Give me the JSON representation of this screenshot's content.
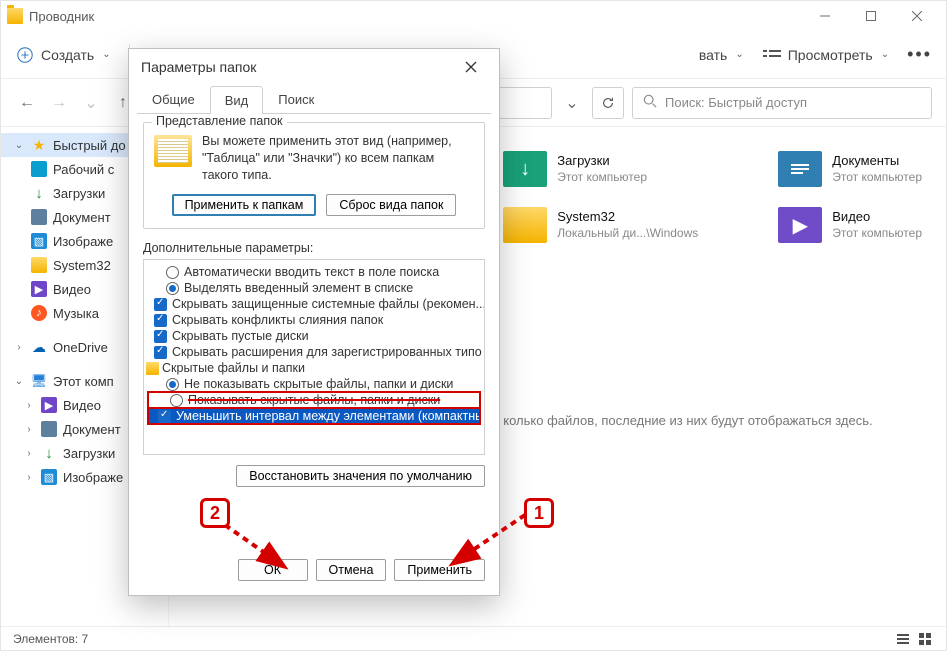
{
  "title": "Проводник",
  "toolbar": {
    "create": "Создать",
    "sort": "вать",
    "view": "Просмотреть"
  },
  "nav": {
    "search_placeholder": "Поиск: Быстрый доступ"
  },
  "sidebar": {
    "quick_access": "Быстрый до",
    "desktop": "Рабочий с",
    "downloads": "Загрузки",
    "documents": "Документ",
    "images": "Изображе",
    "system32": "System32",
    "video": "Видео",
    "music": "Музыка",
    "onedrive": "OneDrive",
    "this_pc": "Этот комп",
    "pc_video": "Видео",
    "pc_documents": "Документ",
    "pc_downloads": "Загрузки",
    "pc_images": "Изображе"
  },
  "folders": {
    "downloads": {
      "title": "Загрузки",
      "sub": "Этот компьютер"
    },
    "system32": {
      "title": "System32",
      "sub": "Локальный ди...\\Windows"
    },
    "documents": {
      "title": "Документы",
      "sub": "Этот компьютер"
    },
    "video": {
      "title": "Видео",
      "sub": "Этот компьютер"
    }
  },
  "hint": "колько файлов, последние из них будут отображаться здесь.",
  "status": "Элементов: 7",
  "dialog": {
    "title": "Параметры папок",
    "tabs": {
      "general": "Общие",
      "view": "Вид",
      "search": "Поиск"
    },
    "group_legend": "Представление папок",
    "group_text": "Вы можете применить этот вид (например, \"Таблица\" или \"Значки\") ко всем папкам такого типа.",
    "apply_to_folders": "Применить к папкам",
    "reset_folders": "Сброс вида папок",
    "advanced_label": "Дополнительные параметры:",
    "options": {
      "o1": "Автоматически вводить текст в поле поиска",
      "o2": "Выделять введенный элемент в списке",
      "o3": "Скрывать защищенные системные файлы (рекомен...",
      "o4": "Скрывать конфликты слияния папок",
      "o5": "Скрывать пустые диски",
      "o6": "Скрывать расширения для зарегистрированных типо",
      "o7": "Скрытые файлы и папки",
      "o8": "Не показывать скрытые файлы, папки и диски",
      "o9": "Показывать скрытые файлы, папки и диски",
      "o10": "Уменьшить интервал между элементами (компактны"
    },
    "restore_defaults": "Восстановить значения по умолчанию",
    "ok": "ОК",
    "cancel": "Отмена",
    "apply": "Применить"
  },
  "annotation": {
    "one": "1",
    "two": "2"
  }
}
